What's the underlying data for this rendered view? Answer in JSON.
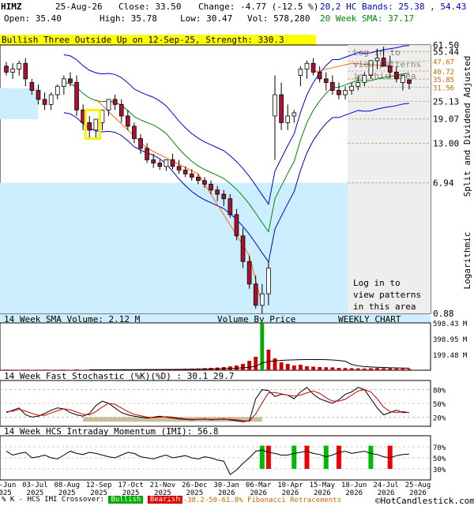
{
  "header": {
    "symbol": "HIMZ",
    "date": "25-Aug-26",
    "close": "Close: 33.50",
    "change": "Change: -4.77 (-12.5 %)",
    "open": "Open: 35.40",
    "high": "High: 35.78",
    "low": "Low: 30.47",
    "vol": "Vol: 578,280",
    "bb": "20,2 HC Bands: 25.38 , 54.43",
    "sma": "20 Week SMA: 37.17",
    "pattern": "Bullish Three Outside Up on 12-Sep-25, Strength: 330.3"
  },
  "main_panel": {
    "right_label": "Split and Dividend Adjusted",
    "log_label": "Logarithmic",
    "login_text": [
      "Log in to",
      "view patterns",
      "in this area"
    ],
    "watermark": "HotCandlestick.com",
    "chart_label": "WEEKLY CHART",
    "vbp_label": "Volume By Price",
    "y_ticks": [
      "61.50",
      "55.44",
      "47.67",
      "40.72",
      "35.85",
      "31.56",
      "25.13",
      "19.07",
      "13.00",
      "6.94",
      "0.88"
    ],
    "fib_ticks": [
      "47.67",
      "40.72",
      "35.85",
      "31.56"
    ]
  },
  "volume_panel": {
    "title": "14 Week SMA Volume: 2.12 M",
    "y_ticks": [
      "598.43 M",
      "398.95 M",
      "199.48 M"
    ]
  },
  "stoch_panel": {
    "title": "14 Week Fast Stochastic (%K)(%D) : 30.1 29.7",
    "y_ticks": [
      "80%",
      "50%",
      "20%"
    ]
  },
  "imi_panel": {
    "title": "14 Week HCS Intraday Momentum (IMI): 56.8",
    "y_ticks": [
      "70%",
      "50%",
      "30%"
    ]
  },
  "x_labels": [
    [
      "06-Jun",
      "2025"
    ],
    [
      "03-Jul",
      "2025"
    ],
    [
      "08-Aug",
      "2025"
    ],
    [
      "12-Sep",
      "2025"
    ],
    [
      "17-Oct",
      "2025"
    ],
    [
      "21-Nov",
      "2025"
    ],
    [
      "26-Dec",
      "2025"
    ],
    [
      "30-Jan",
      "2026"
    ],
    [
      "06-Mar",
      "2026"
    ],
    [
      "10-Apr",
      "2026"
    ],
    [
      "15-May",
      "2026"
    ],
    [
      "18-Jun",
      "2026"
    ],
    [
      "24-Jul",
      "2026"
    ],
    [
      "25-Aug",
      "2026"
    ]
  ],
  "legend": {
    "prefix": "% K - HCS IMI Crossover:",
    "bullish": "Bullish",
    "bearish": "Bearish",
    "fib": "23.6-38.2-50-61.8% Fibonacci Retracements",
    "site": "©HotCandlestick.com"
  },
  "colors": {
    "bull_fill": "#ffffff",
    "bear_fill": "#aa1133",
    "sma": "#008800",
    "bands": "#0000cc",
    "trend": "#ff6600",
    "shade": "#cceeff",
    "vol": "#cc0000",
    "vol_high": "#00aa00",
    "stoch_k": "#000000",
    "stoch_d": "#cc0000"
  },
  "chart_data": {
    "type": "candlestick",
    "title": "HIMZ weekly",
    "scale": "log",
    "ylim": [
      0.88,
      61.5
    ],
    "x": [
      "06-Jun-25",
      "13-Jun-25",
      "20-Jun-25",
      "27-Jun-25",
      "04-Jul-25",
      "11-Jul-25",
      "18-Jul-25",
      "25-Jul-25",
      "01-Aug-25",
      "08-Aug-25",
      "15-Aug-25",
      "22-Aug-25",
      "29-Aug-25",
      "05-Sep-25",
      "12-Sep-25",
      "19-Sep-25",
      "26-Sep-25",
      "03-Oct-25",
      "10-Oct-25",
      "17-Oct-25",
      "24-Oct-25",
      "31-Oct-25",
      "07-Nov-25",
      "14-Nov-25",
      "21-Nov-25",
      "28-Nov-25",
      "05-Dec-25",
      "12-Dec-25",
      "19-Dec-25",
      "26-Dec-25",
      "02-Jan-26",
      "09-Jan-26",
      "16-Jan-26",
      "23-Jan-26",
      "30-Jan-26",
      "06-Feb-26",
      "13-Feb-26",
      "20-Feb-26",
      "27-Feb-26",
      "06-Mar-26",
      "13-Mar-26",
      "20-Mar-26",
      "27-Mar-26",
      "03-Apr-26",
      "10-Apr-26",
      "17-Apr-26",
      "24-Apr-26",
      "01-May-26",
      "08-May-26",
      "15-May-26",
      "22-May-26",
      "29-May-26",
      "05-Jun-26",
      "12-Jun-26",
      "19-Jun-26",
      "26-Jun-26",
      "03-Jul-26",
      "10-Jul-26",
      "17-Jul-26",
      "24-Jul-26",
      "31-Jul-26",
      "07-Aug-26",
      "14-Aug-26",
      "25-Aug-26"
    ],
    "open": [
      44,
      40,
      42,
      46,
      34,
      30,
      26,
      24,
      28,
      32,
      36,
      34,
      22,
      18,
      16,
      18,
      22,
      26,
      24,
      20,
      17,
      14,
      12,
      10,
      9.5,
      9,
      10,
      9,
      8.5,
      8,
      7.6,
      7.2,
      6.8,
      6.2,
      5.8,
      5.4,
      4.2,
      3.0,
      2.0,
      1.4,
      1.0,
      1.2,
      20,
      28,
      18,
      20,
      38,
      42,
      46,
      40,
      36,
      34,
      30,
      28,
      30,
      32,
      34,
      38,
      48,
      50,
      44,
      40,
      34,
      35.4
    ],
    "high": [
      47,
      46,
      48,
      50,
      36,
      33,
      29,
      29,
      33,
      38,
      40,
      38,
      24,
      20,
      19,
      21,
      26,
      28,
      26,
      22,
      18,
      15,
      13,
      11,
      10,
      10,
      11,
      10,
      9,
      8.6,
      8,
      7.6,
      7.2,
      6.6,
      6.2,
      5.8,
      4.6,
      3.4,
      2.2,
      1.6,
      1.4,
      2.0,
      38,
      34,
      24,
      22,
      44,
      48,
      50,
      44,
      40,
      38,
      34,
      32,
      34,
      38,
      40,
      46,
      58,
      60,
      52,
      44,
      38,
      35.78
    ],
    "low": [
      38,
      36,
      38,
      32,
      28,
      24,
      22,
      22,
      26,
      28,
      32,
      20,
      16,
      14,
      14,
      16,
      20,
      22,
      18,
      16,
      13,
      11,
      9.5,
      8.8,
      8.5,
      8.4,
      8.6,
      8,
      7.6,
      7.2,
      6.8,
      6.4,
      5.8,
      5.2,
      4.8,
      4.0,
      2.8,
      1.8,
      1.3,
      0.95,
      0.88,
      1.0,
      10,
      16,
      16,
      18,
      32,
      36,
      38,
      34,
      30,
      28,
      26,
      26,
      28,
      30,
      32,
      36,
      42,
      44,
      36,
      34,
      30,
      30.47
    ],
    "close": [
      40,
      42,
      46,
      36,
      30,
      26,
      24,
      28,
      32,
      36,
      34,
      22,
      18,
      16,
      19,
      22,
      26,
      24,
      20,
      17,
      14,
      12,
      10,
      9.5,
      9,
      10,
      9,
      8.5,
      8,
      7.6,
      7.2,
      6.8,
      6.2,
      5.8,
      5.4,
      4.2,
      3.0,
      2.0,
      1.4,
      1.0,
      1.2,
      1.8,
      28,
      18,
      20,
      21,
      42,
      46,
      40,
      36,
      34,
      30,
      28,
      30,
      32,
      34,
      38,
      48,
      50,
      44,
      40,
      36,
      38,
      33.5
    ],
    "volume_millions": [
      8,
      6,
      5,
      7,
      5,
      6,
      7,
      5,
      6,
      8,
      5,
      9,
      6,
      7,
      10,
      8,
      7,
      6,
      8,
      9,
      10,
      12,
      14,
      11,
      13,
      15,
      12,
      14,
      18,
      20,
      22,
      26,
      30,
      34,
      40,
      48,
      60,
      80,
      120,
      170,
      598,
      260,
      150,
      100,
      80,
      60,
      70,
      50,
      45,
      40,
      38,
      36,
      30,
      28,
      26,
      24,
      22,
      25,
      28,
      26,
      24,
      22,
      20,
      18
    ],
    "stoch_k": [
      30,
      35,
      40,
      25,
      20,
      22,
      28,
      35,
      40,
      38,
      30,
      25,
      22,
      28,
      45,
      55,
      50,
      40,
      30,
      25,
      22,
      20,
      18,
      20,
      22,
      20,
      18,
      16,
      15,
      14,
      15,
      16,
      14,
      15,
      16,
      14,
      12,
      10,
      12,
      60,
      80,
      78,
      65,
      70,
      68,
      60,
      75,
      85,
      70,
      60,
      55,
      50,
      58,
      70,
      75,
      85,
      80,
      60,
      40,
      25,
      30,
      35,
      30,
      30.1
    ],
    "stoch_d": [
      32,
      33,
      37,
      33,
      28,
      24,
      24,
      29,
      34,
      38,
      36,
      31,
      26,
      25,
      32,
      42,
      50,
      48,
      40,
      32,
      26,
      23,
      20,
      19,
      20,
      21,
      20,
      18,
      16,
      15,
      15,
      15,
      15,
      15,
      15,
      15,
      14,
      12,
      11,
      27,
      51,
      73,
      74,
      71,
      68,
      66,
      68,
      73,
      77,
      72,
      62,
      55,
      55,
      59,
      68,
      77,
      80,
      75,
      60,
      42,
      32,
      30,
      32,
      29.7
    ],
    "imi": [
      62,
      55,
      58,
      60,
      50,
      52,
      55,
      50,
      48,
      55,
      62,
      58,
      56,
      60,
      58,
      55,
      52,
      50,
      55,
      60,
      58,
      52,
      50,
      48,
      52,
      55,
      50,
      52,
      54,
      50,
      48,
      52,
      50,
      46,
      44,
      20,
      28,
      40,
      50,
      62,
      64,
      60,
      58,
      55,
      55,
      58,
      60,
      62,
      58,
      56,
      52,
      55,
      60,
      62,
      58,
      60,
      62,
      58,
      56,
      52,
      50,
      54,
      56,
      56.8
    ]
  }
}
